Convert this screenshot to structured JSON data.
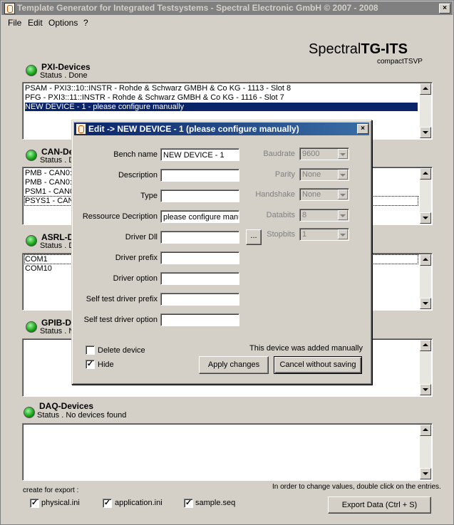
{
  "window": {
    "title": "Template Generator for Integrated Testsystems - Spectral Electronic GmbH © 2007 - 2008"
  },
  "menu": [
    "File",
    "Edit",
    "Options",
    "?"
  ],
  "brand": {
    "name_a": "Spectral",
    "name_b": "TG-ITS",
    "sub": "compactTSVP"
  },
  "sections": {
    "pxi": {
      "title": "PXI-Devices",
      "status": "Status . Done",
      "items": [
        "PSAM - PXI3::10::INSTR - Rohde & Schwarz GMBH & Co KG - 1113 - Slot 8",
        "PFG - PXI3::11::INSTR - Rohde & Schwarz GMBH & Co KG - 1116 - Slot 7",
        "NEW DEVICE - 1 - please configure manually"
      ]
    },
    "can": {
      "title": "CAN-De",
      "status": "Status . D",
      "items": [
        "PMB - CAN0::",
        "PMB - CAN0::",
        "PSM1 - CAN0:",
        "PSYS1 - CAN("
      ]
    },
    "asrl": {
      "title": "ASRL-D",
      "status": "Status . D",
      "items": [
        "COM1",
        "COM10"
      ]
    },
    "gpib": {
      "title": "GPIB-De",
      "status": "Status . N",
      "items": []
    },
    "daq": {
      "title": "DAQ-Devices",
      "status": "Status . No devices found",
      "items": []
    }
  },
  "hint": "In order to change values, double click on the entries.",
  "export": {
    "label": "create for export :",
    "options": [
      {
        "label": "physical.ini",
        "checked": true
      },
      {
        "label": "application.ini",
        "checked": true
      },
      {
        "label": "sample.seq",
        "checked": true
      }
    ],
    "button": "Export Data (Ctrl + S)"
  },
  "dialog": {
    "title": "Edit -> NEW DEVICE - 1 (please configure manually)",
    "fields": [
      {
        "label": "Bench name",
        "value": "NEW DEVICE - 1"
      },
      {
        "label": "Description",
        "value": ""
      },
      {
        "label": "Type",
        "value": ""
      },
      {
        "label": "Ressource Decription",
        "value": "please configure manu"
      },
      {
        "label": "Driver Dll",
        "value": ""
      },
      {
        "label": "Driver prefix",
        "value": ""
      },
      {
        "label": "Driver option",
        "value": ""
      },
      {
        "label": "Self test driver prefix",
        "value": ""
      },
      {
        "label": "Self test driver option",
        "value": ""
      }
    ],
    "browse": "...",
    "serial": [
      {
        "label": "Baudrate",
        "value": "9600"
      },
      {
        "label": "Parity",
        "value": "None"
      },
      {
        "label": "Handshake",
        "value": "None"
      },
      {
        "label": "Databits",
        "value": "8"
      },
      {
        "label": "Stopbits",
        "value": "1"
      }
    ],
    "note": "This device was added manually",
    "delete_label": "Delete device",
    "delete_checked": false,
    "hide_label": "Hide",
    "hide_checked": true,
    "apply": "Apply changes",
    "cancel": "Cancel without saving"
  }
}
